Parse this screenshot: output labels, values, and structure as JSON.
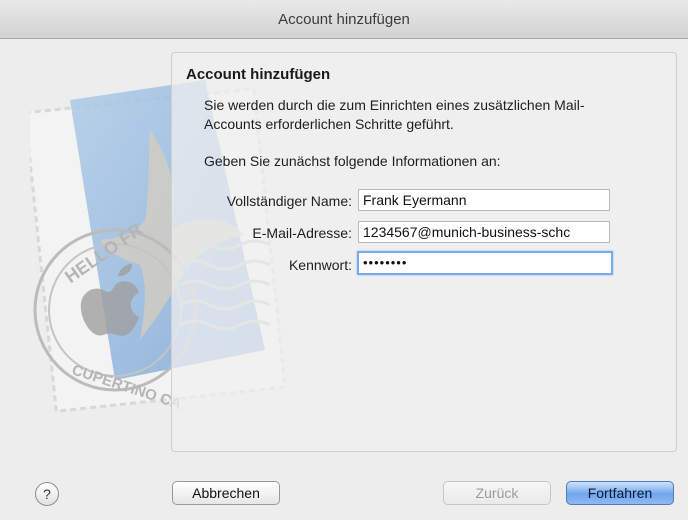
{
  "window": {
    "title": "Account hinzufügen"
  },
  "content": {
    "heading": "Account hinzufügen",
    "intro": "Sie werden durch die zum Einrichten eines zusätzlichen Mail-Accounts erforderlichen Schritte geführt.",
    "prompt": "Geben Sie zunächst folgende Informationen an:"
  },
  "form": {
    "name_label": "Vollständiger Name:",
    "name_value": "Frank Eyermann",
    "email_label": "E-Mail-Adresse:",
    "email_value": "1234567@munich-business-schc",
    "password_label": "Kennwort:",
    "password_value": "••••••••"
  },
  "buttons": {
    "help": "?",
    "cancel": "Abbrechen",
    "back": "Zurück",
    "continue": "Fortfahren"
  },
  "stamp": {
    "text_top": "HELLO FR",
    "text_bottom": "CUPERTINO CA"
  },
  "colors": {
    "focus_ring": "#79a9e8",
    "primary_button": "#6fa6ee"
  }
}
